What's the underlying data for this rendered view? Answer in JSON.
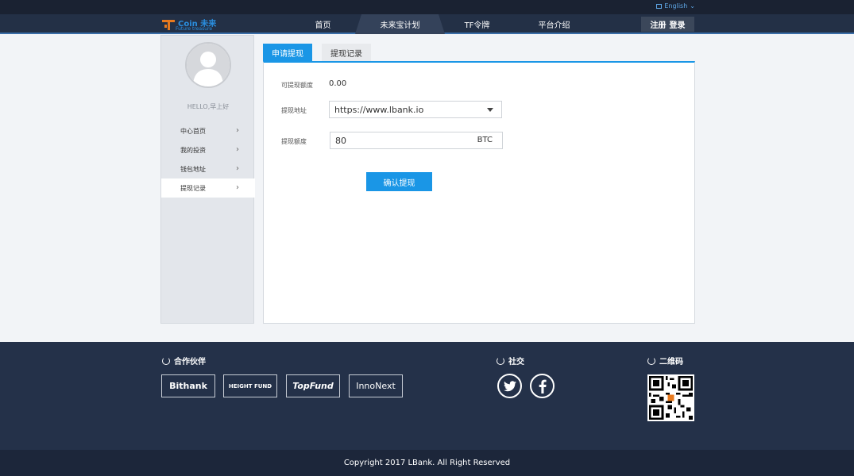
{
  "topbar": {
    "language": "English"
  },
  "header": {
    "logo_text": "Coin 未来",
    "logo_sub": "Future treasure",
    "nav": [
      {
        "label": "首页"
      },
      {
        "label": "未来宝计划"
      },
      {
        "label": "TF令牌"
      },
      {
        "label": "平台介绍"
      }
    ],
    "register": "注册",
    "login": "登录"
  },
  "sidebar": {
    "greeting": "HELLO,早上好",
    "items": [
      {
        "label": "中心首页"
      },
      {
        "label": "我的投资"
      },
      {
        "label": "钱包地址"
      },
      {
        "label": "提现记录"
      }
    ]
  },
  "tabs": [
    {
      "label": "申请提现"
    },
    {
      "label": "提现记录"
    }
  ],
  "form": {
    "available_label": "可提现额度",
    "available_value": "0.00",
    "address_label": "提现地址",
    "address_value": "https://www.lbank.io",
    "amount_label": "提现额度",
    "amount_value": "80",
    "amount_unit": "BTC",
    "confirm": "确认提现"
  },
  "footer": {
    "partners_title": "合作伙伴",
    "partners": [
      "Bithank",
      "HEIGHT FUND",
      "TopFund",
      "InnoNext"
    ],
    "social_title": "社交",
    "qr_title": "二维码",
    "copyright": "Copyright 2017 LBank. All Right Reserved"
  },
  "colors": {
    "accent": "#1a96e6",
    "header": "#233046",
    "footer": "#243149"
  }
}
